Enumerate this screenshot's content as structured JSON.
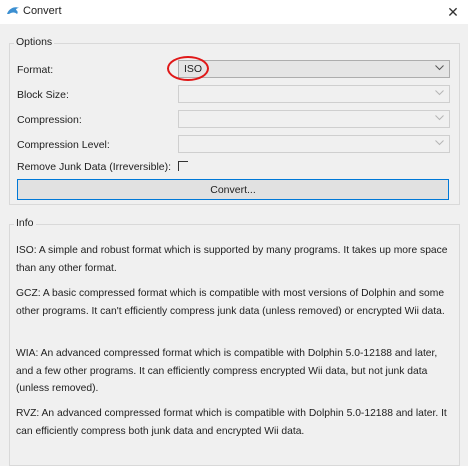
{
  "window": {
    "title": "Convert",
    "close_glyph": "✕"
  },
  "options": {
    "title": "Options",
    "format_label": "Format:",
    "format_value": "ISO",
    "block_size_label": "Block Size:",
    "compression_label": "Compression:",
    "compression_level_label": "Compression Level:",
    "remove_junk_label": "Remove Junk Data (Irreversible):",
    "remove_junk_checked": false,
    "convert_button": "Convert..."
  },
  "info": {
    "title": "Info",
    "paragraphs": [
      "ISO: A simple and robust format which is supported by many programs. It takes up more space than any other format.",
      "GCZ: A basic compressed format which is compatible with most versions of Dolphin and some other programs. It can't efficiently compress junk data (unless removed) or encrypted Wii data.",
      "WIA: An advanced compressed format which is compatible with Dolphin 5.0-12188 and later, and a few other programs. It can efficiently compress encrypted Wii data, but not junk data (unless removed).",
      "RVZ: An advanced compressed format which is compatible with Dolphin 5.0-12188 and later. It can efficiently compress both junk data and encrypted Wii data."
    ]
  },
  "colors": {
    "highlight": "#e01818",
    "button_focus": "#0078d7"
  }
}
